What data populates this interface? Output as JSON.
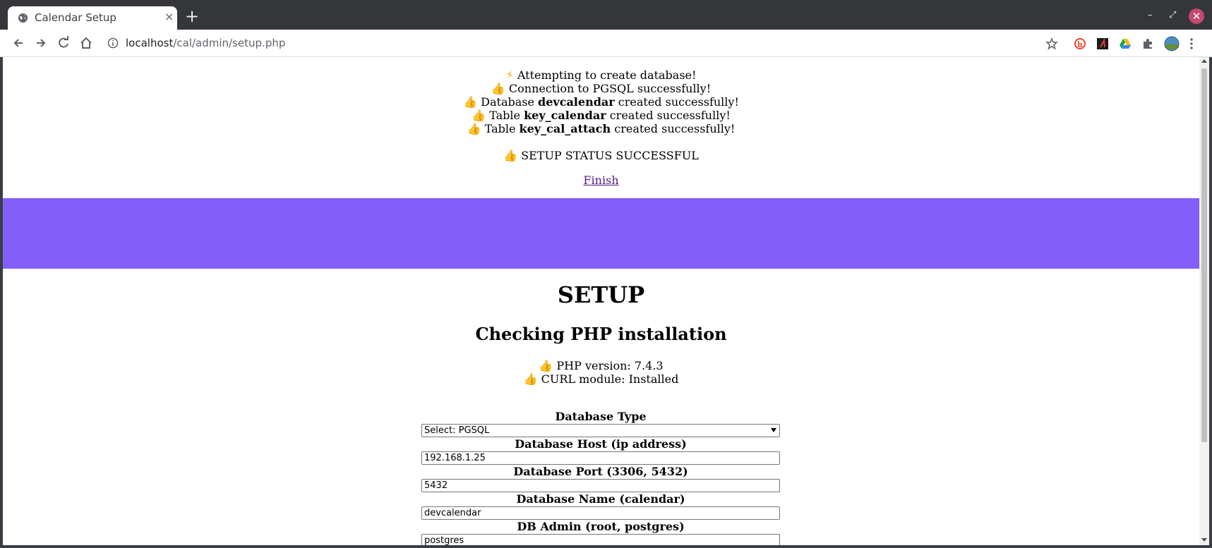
{
  "browser": {
    "tab_title": "Calendar Setup",
    "tab_close": "×",
    "new_tab": "+",
    "url_host": "localhost",
    "url_path": "/cal/admin/setup.php",
    "minimize": "–",
    "maximize": "⤢",
    "close": "✕"
  },
  "messages": {
    "lines": [
      {
        "emoji": "⚡",
        "pre": "Attempting to create database!",
        "bold": "",
        "post": ""
      },
      {
        "emoji": "👍",
        "pre": "Connection to PGSQL successfully!",
        "bold": "",
        "post": ""
      },
      {
        "emoji": "👍",
        "pre": "Database ",
        "bold": "devcalendar",
        "post": " created successfully!"
      },
      {
        "emoji": "👍",
        "pre": "Table ",
        "bold": "key_calendar",
        "post": " created successfully!"
      },
      {
        "emoji": "👍",
        "pre": "Table ",
        "bold": "key_cal_attach",
        "post": " created successfully!"
      }
    ],
    "status_emoji": "👍",
    "status": "SETUP STATUS SUCCESSFUL",
    "finish_link": "Finish"
  },
  "colors": {
    "banner": "#835efb",
    "link": "#551a8b"
  },
  "setup": {
    "title": "SETUP",
    "subtitle": "Checking PHP installation",
    "checks": [
      {
        "emoji": "👍",
        "text": "PHP version: 7.4.3"
      },
      {
        "emoji": "👍",
        "text": "CURL module: Installed"
      }
    ]
  },
  "form": {
    "db_type_label": "Database Type",
    "db_type_value": "Select: PGSQL",
    "db_host_label": "Database Host (ip address)",
    "db_host_value": "192.168.1.25",
    "db_port_label": "Database Port (3306, 5432)",
    "db_port_value": "5432",
    "db_name_label": "Database Name (calendar)",
    "db_name_value": "devcalendar",
    "db_admin_label": "DB Admin (root, postgres)",
    "db_admin_value": "postgres"
  }
}
